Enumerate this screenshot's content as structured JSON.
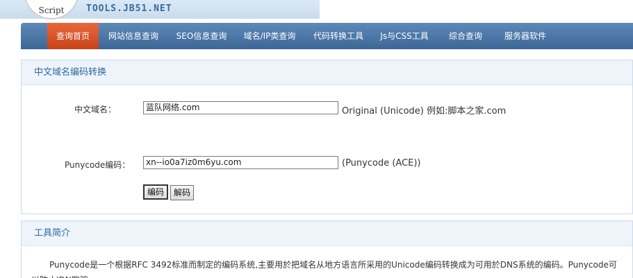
{
  "header": {
    "logo_text": "Script",
    "site_url": "TOOLS.JB51.NET"
  },
  "nav": {
    "items": [
      {
        "label": "查询首页",
        "active": true
      },
      {
        "label": "网站信息查询"
      },
      {
        "label": "SEO信息查询"
      },
      {
        "label": "域名/IP类查询"
      },
      {
        "label": "代码转换工具"
      },
      {
        "label": "Js与CSS工具"
      },
      {
        "label": "综合查询"
      },
      {
        "label": "服务器软件"
      }
    ]
  },
  "converter": {
    "title": "中文域名编码转换",
    "cn_label": "中文域名：",
    "cn_value": "蓝队网络.com",
    "cn_hint": "Original (Unicode) 例如:脚本之家.com",
    "puny_label": "Punycode编码：",
    "puny_value": "xn--io0a7iz0m6yu.com",
    "puny_hint": "(Punycode (ACE))",
    "encode_label": "编码",
    "decode_label": "解码"
  },
  "intro": {
    "title": "工具简介",
    "text": "Punycode是一个根据RFC 3492标准而制定的编码系统,主要用於把域名从地方语言所采用的Unicode编码转换成为可用於DNS系统的编码。Punycode可以防止IDN欺骗"
  },
  "colors": {
    "nav_bg": "#4a76a6",
    "nav_active": "#d9501f",
    "panel_title": "#2c6aa0"
  }
}
